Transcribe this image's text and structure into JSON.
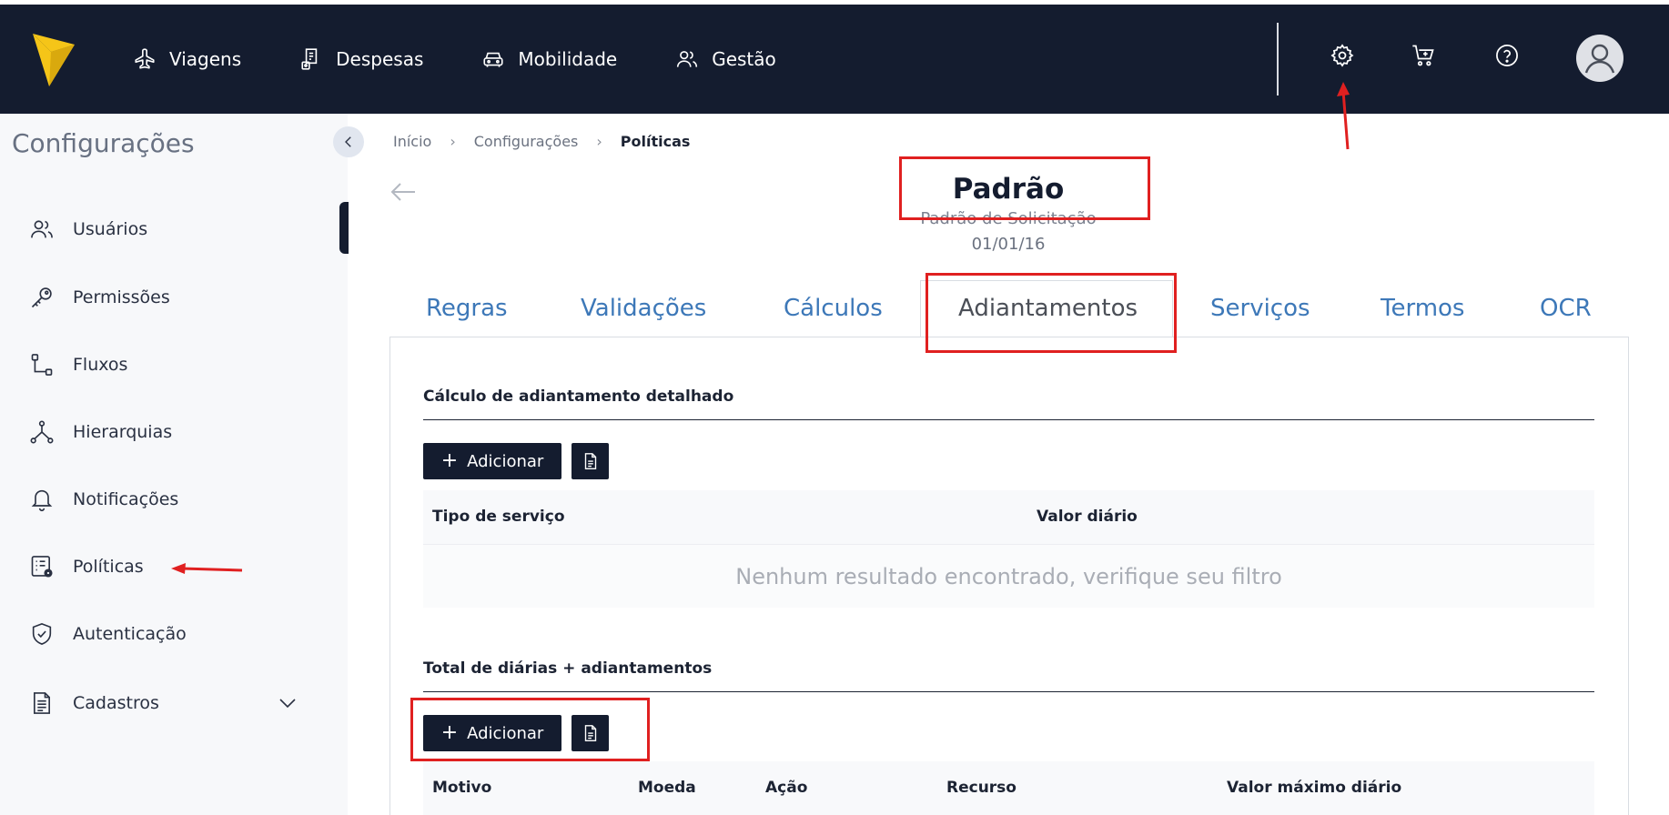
{
  "nav": {
    "items": [
      {
        "label": "Viagens",
        "icon": "airplane-icon"
      },
      {
        "label": "Despesas",
        "icon": "receipt-icon"
      },
      {
        "label": "Mobilidade",
        "icon": "car-icon"
      },
      {
        "label": "Gestão",
        "icon": "users-icon"
      }
    ],
    "right_icons": [
      "gear-icon",
      "cart-plus-icon",
      "help-icon",
      "user-avatar-icon"
    ]
  },
  "sidebar": {
    "title": "Configurações",
    "items": [
      {
        "label": "Usuários",
        "icon": "users-icon"
      },
      {
        "label": "Permissões",
        "icon": "key-icon"
      },
      {
        "label": "Fluxos",
        "icon": "flow-icon"
      },
      {
        "label": "Hierarquias",
        "icon": "hierarchy-icon"
      },
      {
        "label": "Notificações",
        "icon": "bell-icon"
      },
      {
        "label": "Políticas",
        "icon": "policy-icon"
      },
      {
        "label": "Autenticação",
        "icon": "shield-check-icon"
      },
      {
        "label": "Cadastros",
        "icon": "document-icon"
      }
    ]
  },
  "breadcrumb": {
    "items": [
      "Início",
      "Configurações",
      "Políticas"
    ]
  },
  "policy": {
    "title": "Padrão",
    "subtitle": "Padrão de Solicitação",
    "date": "01/01/16"
  },
  "tabs": [
    {
      "label": "Regras"
    },
    {
      "label": "Validações"
    },
    {
      "label": "Cálculos"
    },
    {
      "label": "Adiantamentos"
    },
    {
      "label": "Serviços"
    },
    {
      "label": "Termos"
    },
    {
      "label": "OCR"
    }
  ],
  "sections": {
    "advance_calc": {
      "title": "Cálculo de adiantamento detalhado",
      "add_label": "Adicionar",
      "columns": [
        "Tipo de serviço",
        "Valor diário"
      ],
      "empty_message": "Nenhum resultado encontrado, verifique seu filtro"
    },
    "daily_total": {
      "title": "Total de diárias + adiantamentos",
      "add_label": "Adicionar",
      "columns": [
        "Motivo",
        "Moeda",
        "Ação",
        "Recurso",
        "Valor máximo diário"
      ]
    }
  },
  "colors": {
    "topbar": "#141c2f",
    "accent_tab": "#3d78b8",
    "annotation": "#e02020",
    "logo": "#f5c518"
  }
}
